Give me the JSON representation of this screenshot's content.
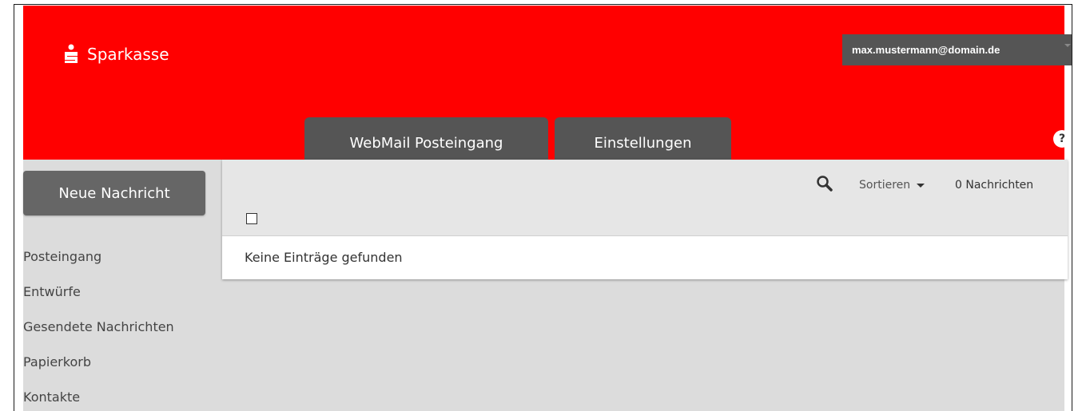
{
  "brand": {
    "name": "Sparkasse"
  },
  "user": {
    "email": "max.mustermann@domain.de"
  },
  "tabs": [
    {
      "label": "WebMail Posteingang"
    },
    {
      "label": "Einstellungen"
    }
  ],
  "help": {
    "label": "?"
  },
  "sidebar": {
    "new_message_label": "Neue Nachricht",
    "items": [
      {
        "label": "Posteingang"
      },
      {
        "label": "Entwürfe"
      },
      {
        "label": "Gesendete Nachrichten"
      },
      {
        "label": "Papierkorb"
      },
      {
        "label": "Kontakte"
      }
    ]
  },
  "toolbar": {
    "sort_label": "Sortieren",
    "message_count": "0 Nachrichten"
  },
  "list": {
    "empty_message": "Keine Einträge gefunden"
  },
  "colors": {
    "header": "#ff0000",
    "tab": "#555555",
    "content_bg": "#dcdcdc"
  }
}
